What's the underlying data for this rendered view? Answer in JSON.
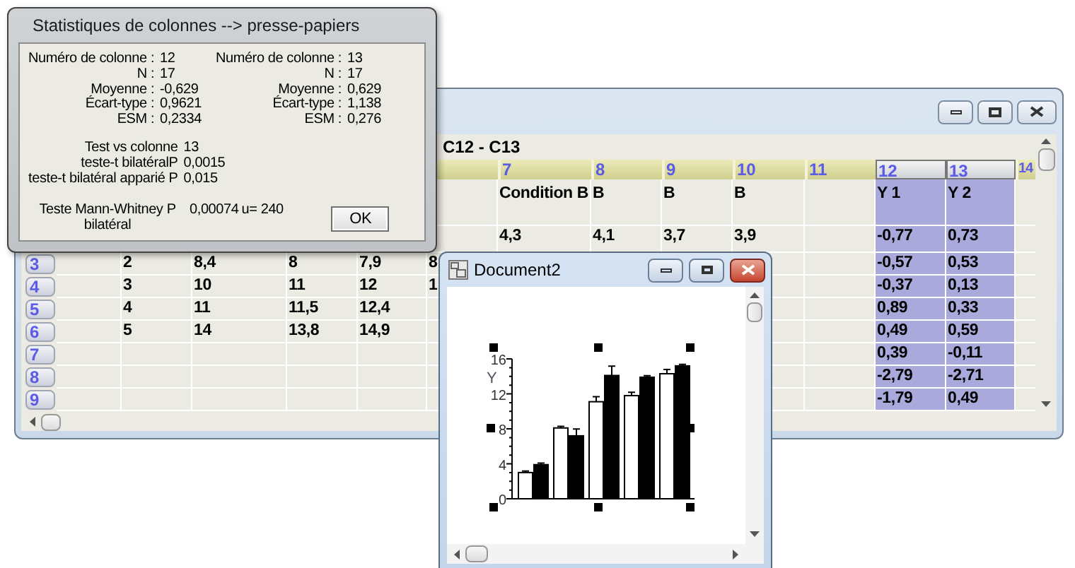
{
  "stats_dialog": {
    "title": "Statistiques de colonnes --> presse-papiers",
    "columns": [
      {
        "rows": [
          {
            "label": "Numéro de colonne :",
            "value": "12"
          },
          {
            "label": "N :",
            "value": "17"
          },
          {
            "label": "Moyenne :",
            "value": "-0,629"
          },
          {
            "label": "Écart-type :",
            "value": "0,9621"
          },
          {
            "label": "ESM :",
            "value": "0,2334"
          }
        ]
      },
      {
        "rows": [
          {
            "label": "Numéro de colonne :",
            "value": "13"
          },
          {
            "label": "N :",
            "value": "17"
          },
          {
            "label": "Moyenne :",
            "value": "0,629"
          },
          {
            "label": "Écart-type :",
            "value": "1,138"
          },
          {
            "label": "ESM :",
            "value": "0,276"
          }
        ]
      }
    ],
    "tests": [
      {
        "label": "Test vs colonne",
        "value": "13"
      },
      {
        "label": "teste-t bilatéralP",
        "value": "0,0015"
      },
      {
        "label": "teste-t bilatéral apparié P",
        "value": "0,015"
      }
    ],
    "mann_whitney": {
      "label": "Teste Mann-Whitney P bilatéral",
      "value": "0,00074",
      "u": "u= 240"
    },
    "ok_button": "OK"
  },
  "spreadsheet_window": {
    "range": "C12 - C13",
    "column_headers": [
      {
        "label": "7",
        "selected": false
      },
      {
        "label": "8",
        "selected": false
      },
      {
        "label": "9",
        "selected": false
      },
      {
        "label": "10",
        "selected": false
      },
      {
        "label": "11",
        "selected": false
      },
      {
        "label": "12",
        "selected": true
      },
      {
        "label": "13",
        "selected": true
      },
      {
        "label": "14",
        "selected": false
      }
    ],
    "rows": [
      {
        "column_7": "Condition B",
        "column_8": "B",
        "column_9": "B",
        "column_10": "B",
        "column_12": "Y 1",
        "column_13": "Y 2"
      },
      {
        "column_7": "4,3",
        "column_8": "4,1",
        "column_9": "3,7",
        "column_10": "3,9",
        "column_12": "-0,77",
        "column_13": "0,73"
      },
      {
        "number": "3",
        "column_2": "2",
        "column_3": "8,4",
        "column_4": "8",
        "column_5": "7,9",
        "column_6": "8",
        "column_12": "-0,57",
        "column_13": "0,53"
      },
      {
        "number": "4",
        "column_2": "3",
        "column_3": "10",
        "column_4": "11",
        "column_5": "12",
        "column_6": "1",
        "column_12": "-0,37",
        "column_13": "0,13"
      },
      {
        "number": "5",
        "column_2": "4",
        "column_3": "11",
        "column_4": "11,5",
        "column_5": "12,4",
        "column_12": "0,89",
        "column_13": "0,33"
      },
      {
        "number": "6",
        "column_2": "5",
        "column_3": "14",
        "column_4": "13,8",
        "column_5": "14,9",
        "column_12": "0,49",
        "column_13": "0,59"
      },
      {
        "number": "7",
        "column_12": "0,39",
        "column_13": "-0,11"
      },
      {
        "number": "8",
        "column_12": "-2,79",
        "column_13": "-2,71"
      },
      {
        "number": "9",
        "column_12": "-1,79",
        "column_13": "0,49"
      }
    ]
  },
  "document_window": {
    "title": "Document2",
    "chart_data": {
      "type": "bar",
      "ylabel": "Y",
      "ylim": [
        0,
        16
      ],
      "yticks": [
        0,
        4,
        8,
        12,
        16
      ],
      "series": [
        {
          "color": "#ffffff",
          "values": [
            3,
            8.1,
            11.1,
            11.8,
            14.3
          ],
          "errors": [
            0.1,
            0.1,
            0.5,
            0.3,
            0.4
          ]
        },
        {
          "color": "#000000",
          "values": [
            3.9,
            7.2,
            14.1,
            13.9,
            15.2
          ],
          "errors": [
            0.1,
            0.7,
            1,
            0.1,
            0.1
          ]
        }
      ]
    }
  }
}
